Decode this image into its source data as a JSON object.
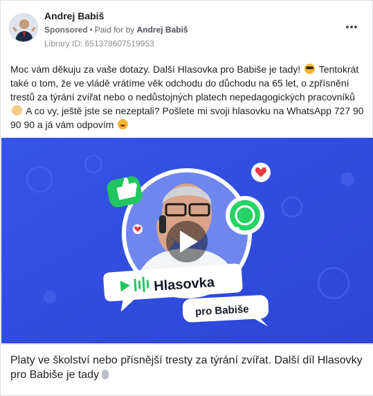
{
  "post": {
    "author": "Andrej Babiš",
    "sponsored": "Sponsored",
    "paid_for_prefix": "Paid for by",
    "paid_for_name": "Andrej Babiš",
    "library_id": "Library ID: 651378607519953",
    "more_icon": "more-horizontal-icon",
    "text_part1": "Moc vám děkuju za vaše dotazy. Další Hlasovka pro Babiše je tady!",
    "emoji1": "smiling-face-with-sunglasses",
    "text_part2": " Tentokrát také o tom, že ve vládě vrátíme věk odchodu do důchodu na 65 let, o zpřísnění trestů za týrání zvířat nebo o nedůstojných platech nepedagogických pracovníků",
    "emoji2": "thinking-face",
    "text_part3": " A co vy, ještě jste se nezeptali? Pošlete mi svoji hlasovku na WhatsApp 727 90 90 90 a já vám odpovím",
    "emoji3": "grinning-face"
  },
  "media": {
    "type": "video",
    "badge_title": "Hlasovka",
    "badge_subtitle": "pro Babiše",
    "play_icon": "play-icon",
    "thumbs_icon": "thumbs-up-icon",
    "heart_icon": "heart-icon",
    "whatsapp_icon": "whatsapp-icon",
    "bg_color": "#3b56e6",
    "accent_green": "#22c55e"
  },
  "caption": {
    "text": "Platy ve školství nebo přísnější tresty za týrání zvířat. Další díl Hlasovky pro Babiše je tady",
    "emoji": "microphone-icon"
  }
}
